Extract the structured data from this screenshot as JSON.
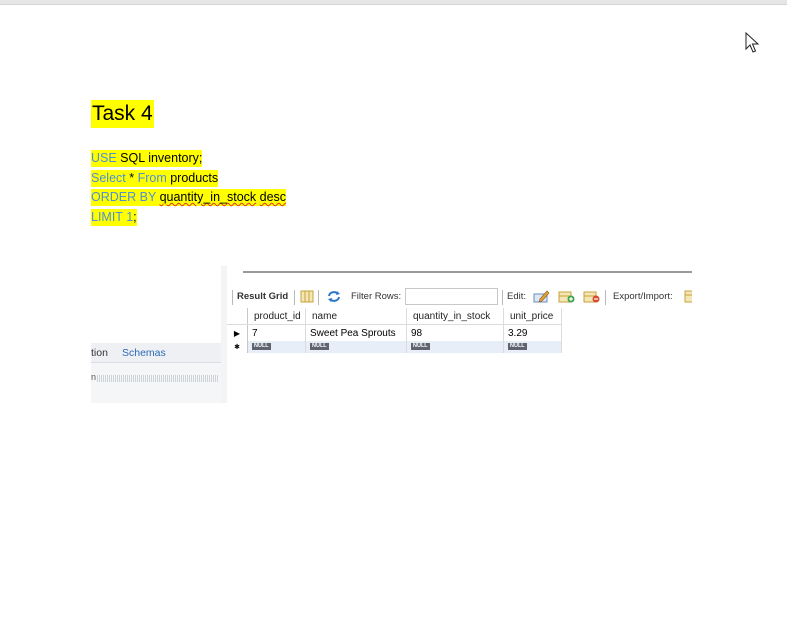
{
  "document": {
    "title": "Task 4",
    "code": {
      "line1": {
        "kw": "USE",
        "rest": " SQL inventory;"
      },
      "line2": {
        "kw1": "Select",
        "mid": " * ",
        "kw2": "From",
        "rest": " products"
      },
      "line3": {
        "kw": "ORDER BY",
        "col": "quantity_in_stock",
        "dir": "desc"
      },
      "line4": {
        "kw": "LIMIT 1",
        "end": ";"
      }
    }
  },
  "screenshot": {
    "left_tabs": {
      "tab1": "tion",
      "tab2": "Schemas"
    },
    "filter_stub": "n",
    "toolbar": {
      "result_grid": "Result Grid",
      "filter_rows": "Filter Rows:",
      "edit": "Edit:",
      "export": "Export/Import:"
    },
    "grid": {
      "columns": [
        "product_id",
        "name",
        "quantity_in_stock",
        "unit_price"
      ],
      "row": [
        "7",
        "Sweet Pea Sprouts",
        "98",
        "3.29"
      ],
      "null_label": "NULL",
      "row_marker": "▶",
      "new_marker": "✱"
    }
  },
  "colors": {
    "highlight": "#ffff00",
    "keyword": "#4f8fd6",
    "link_tab": "#2b6bb8"
  }
}
